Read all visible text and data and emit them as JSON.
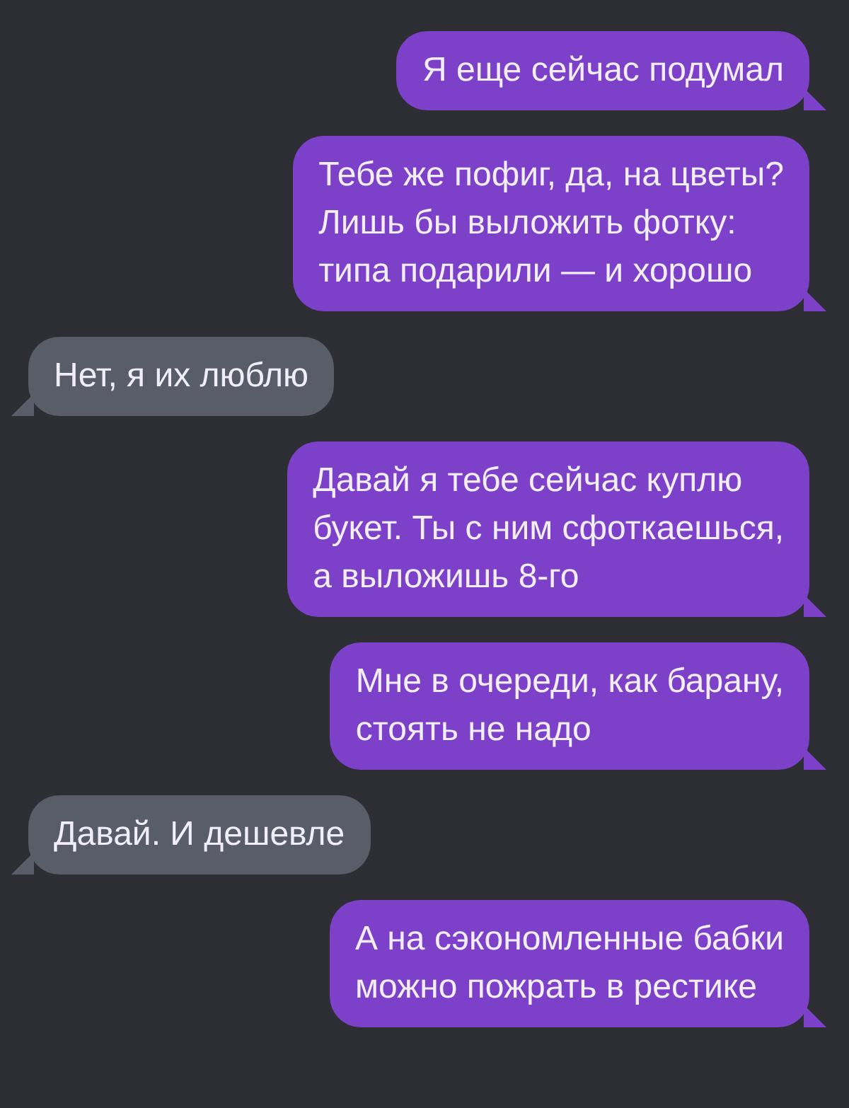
{
  "messages": [
    {
      "kind": "outgoing",
      "text": "Я еще сейчас подумал"
    },
    {
      "kind": "outgoing",
      "text": "Тебе же пофиг, да, на цветы?\nЛишь бы выложить фотку:\nтипа подарили — и хорошо"
    },
    {
      "kind": "incoming",
      "text": "Нет, я их люблю"
    },
    {
      "kind": "outgoing",
      "text": "Давай я тебе сейчас куплю\nбукет. Ты с ним сфоткаешься,\nа выложишь 8-го"
    },
    {
      "kind": "outgoing",
      "text": "Мне в очереди, как барану,\nстоять не надо"
    },
    {
      "kind": "incoming",
      "text": "Давай. И дешевле"
    },
    {
      "kind": "outgoing",
      "text": "А на сэкономленные бабки\nможно пожрать в рестике"
    }
  ]
}
